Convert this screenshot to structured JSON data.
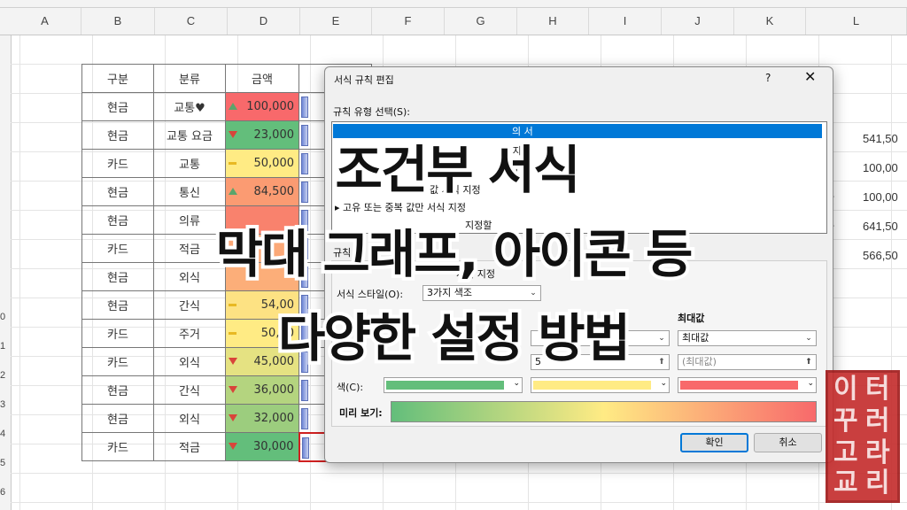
{
  "spreadsheet": {
    "columns": [
      "A",
      "B",
      "C",
      "D",
      "E",
      "F",
      "G",
      "H",
      "I",
      "J",
      "K",
      "L"
    ],
    "row_numbers": [
      "0",
      "1",
      "2",
      "3",
      "4",
      "5",
      "6"
    ],
    "headers": {
      "category": "구분",
      "class": "분류",
      "amount": "금액"
    },
    "rows": [
      {
        "category": "현금",
        "class": "교통♥",
        "amount": "100,000",
        "icon": "arrow-up-icon",
        "color": "#f8696b"
      },
      {
        "category": "현금",
        "class": "교통 요금",
        "amount": "23,000",
        "icon": "arrow-down-icon",
        "color": "#63be7b"
      },
      {
        "category": "카드",
        "class": "교통",
        "amount": "50,000",
        "icon": "dash-icon",
        "color": "#ffeb84"
      },
      {
        "category": "현금",
        "class": "통신",
        "amount": "84,500",
        "icon": "arrow-up-icon",
        "color": "#fb9b72"
      },
      {
        "category": "현금",
        "class": "의류",
        "amount": "",
        "icon": "",
        "color": "#f9826d"
      },
      {
        "category": "카드",
        "class": "적금",
        "amount": "",
        "icon": "",
        "color": "#fba877"
      },
      {
        "category": "현금",
        "class": "외식",
        "amount": "",
        "icon": "",
        "color": "#fcae79"
      },
      {
        "category": "현금",
        "class": "간식",
        "amount": "54,00",
        "icon": "dash-icon",
        "color": "#fde283"
      },
      {
        "category": "카드",
        "class": "주거",
        "amount": "50,00",
        "icon": "dash-icon",
        "color": "#ffeb84"
      },
      {
        "category": "카드",
        "class": "외식",
        "amount": "45,000",
        "icon": "arrow-down-icon",
        "color": "#e5e282"
      },
      {
        "category": "현금",
        "class": "간식",
        "amount": "36,000",
        "icon": "arrow-down-icon",
        "color": "#b4d47f"
      },
      {
        "category": "현금",
        "class": "외식",
        "amount": "32,000",
        "icon": "arrow-down-icon",
        "color": "#9ccd7e"
      },
      {
        "category": "카드",
        "class": "적금",
        "amount": "30,000",
        "icon": "arrow-down-icon",
        "color": "#63be7b"
      }
    ],
    "right_values": [
      "541,50",
      "100,00",
      "100,00",
      "641,50",
      "566,50"
    ],
    "right_keys": [
      "",
      "",
      "값",
      "값",
      ""
    ]
  },
  "dialog": {
    "title": "서식 규칙 편집",
    "help": "?",
    "close": "✕",
    "rule_type_label": "규칙 유형 선택(S):",
    "rule_types": [
      "의 서",
      "식 지",
      "지",
      "값 서식 지정",
      "▸ 고유 또는 중복 값만 서식 지정",
      "지정할"
    ],
    "rule_desc_label": "규칙",
    "section_label": "서식 지정",
    "format_style_label": "서식 스타일(O):",
    "format_style_value": "3가지 색조",
    "max_header": "최대값",
    "max_type": "최대값",
    "max_value_placeholder": "(최대값)",
    "mid_value": "5",
    "color_label": "색(C):",
    "preview_label": "미리 보기:",
    "ok": "확인",
    "cancel": "취소",
    "colors": {
      "min": "#63be7b",
      "mid": "#ffeb84",
      "max": "#f8696b"
    }
  },
  "overlay": {
    "line1": "조건부 서식",
    "line2": "막대 그래프, 아이콘 등",
    "line3": "다양한 설정 방법"
  }
}
